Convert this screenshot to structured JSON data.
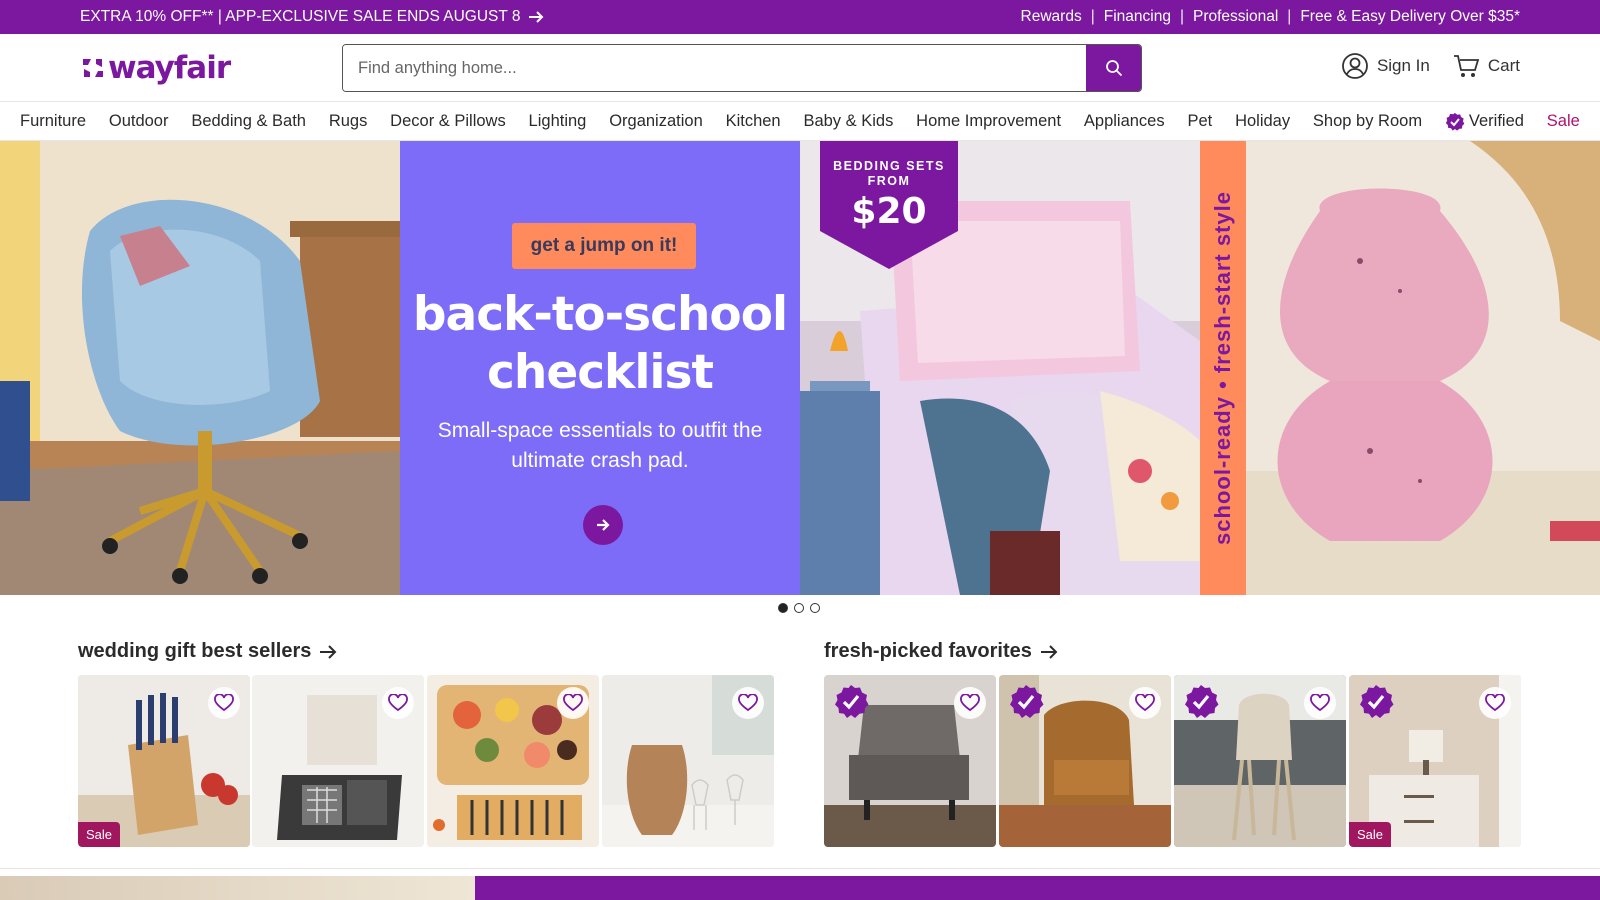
{
  "promo": {
    "left_text": "EXTRA 10% OFF** | APP-EXCLUSIVE SALE ENDS AUGUST 8",
    "links": [
      "Rewards",
      "Financing",
      "Professional",
      "Free & Easy Delivery Over $35*"
    ]
  },
  "header": {
    "logo": "wayfair",
    "search_placeholder": "Find anything home...",
    "sign_in": "Sign In",
    "cart": "Cart"
  },
  "nav": {
    "items": [
      "Furniture",
      "Outdoor",
      "Bedding & Bath",
      "Rugs",
      "Decor & Pillows",
      "Lighting",
      "Organization",
      "Kitchen",
      "Baby & Kids",
      "Home Improvement",
      "Appliances",
      "Pet",
      "Holiday",
      "Shop by Room",
      "Verified",
      "Sale"
    ]
  },
  "hero": {
    "chip": "get a jump on it!",
    "title_line1": "back-to-school",
    "title_line2": "checklist",
    "subtitle": "Small-space essentials to outfit the ultimate crash pad.",
    "badge_line1": "BEDDING SETS",
    "badge_line2": "FROM",
    "badge_price": "$20",
    "vertical_text": "school-ready • fresh-start style",
    "slides": 3,
    "active_slide": 1
  },
  "sections": {
    "wedding": {
      "title": "wedding gift best sellers",
      "tiles": [
        {
          "sale": "Sale"
        },
        {
          "sale": ""
        },
        {
          "sale": ""
        },
        {
          "sale": ""
        }
      ]
    },
    "fresh": {
      "title": "fresh-picked favorites",
      "tiles": [
        {
          "sale": "",
          "verified": true
        },
        {
          "sale": "",
          "verified": true
        },
        {
          "sale": "",
          "verified": true
        },
        {
          "sale": "Sale",
          "verified": true
        }
      ]
    }
  },
  "colors": {
    "brand": "#7b189f",
    "sale": "#a1175f",
    "hero_purple": "#7c6cf7",
    "hero_orange": "#ff8a5c"
  }
}
